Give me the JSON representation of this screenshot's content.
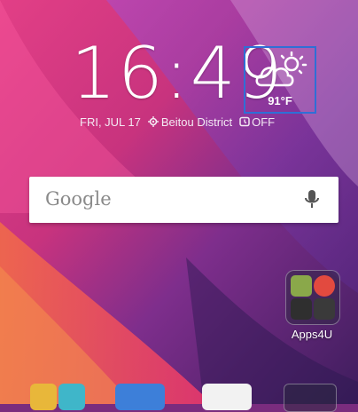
{
  "clock": {
    "hours": "16",
    "minutes": "49"
  },
  "weather": {
    "temperature": "91°F",
    "icon": "partly-cloudy-icon"
  },
  "status_row": {
    "date": "FRI, JUL 17",
    "location": "Beitou District",
    "alarm": "OFF"
  },
  "search": {
    "logo_text": "Google",
    "mic_icon": "mic-icon"
  },
  "folder": {
    "label": "Apps4U"
  },
  "dock": {
    "items": [
      "photos-app-icon",
      "contacts-app-icon",
      "messages-app-icon",
      "play-store-icon",
      "google-apps-folder-icon"
    ]
  },
  "colors": {
    "accent_box": "#2f6fd6",
    "search_bg": "#ffffff"
  }
}
